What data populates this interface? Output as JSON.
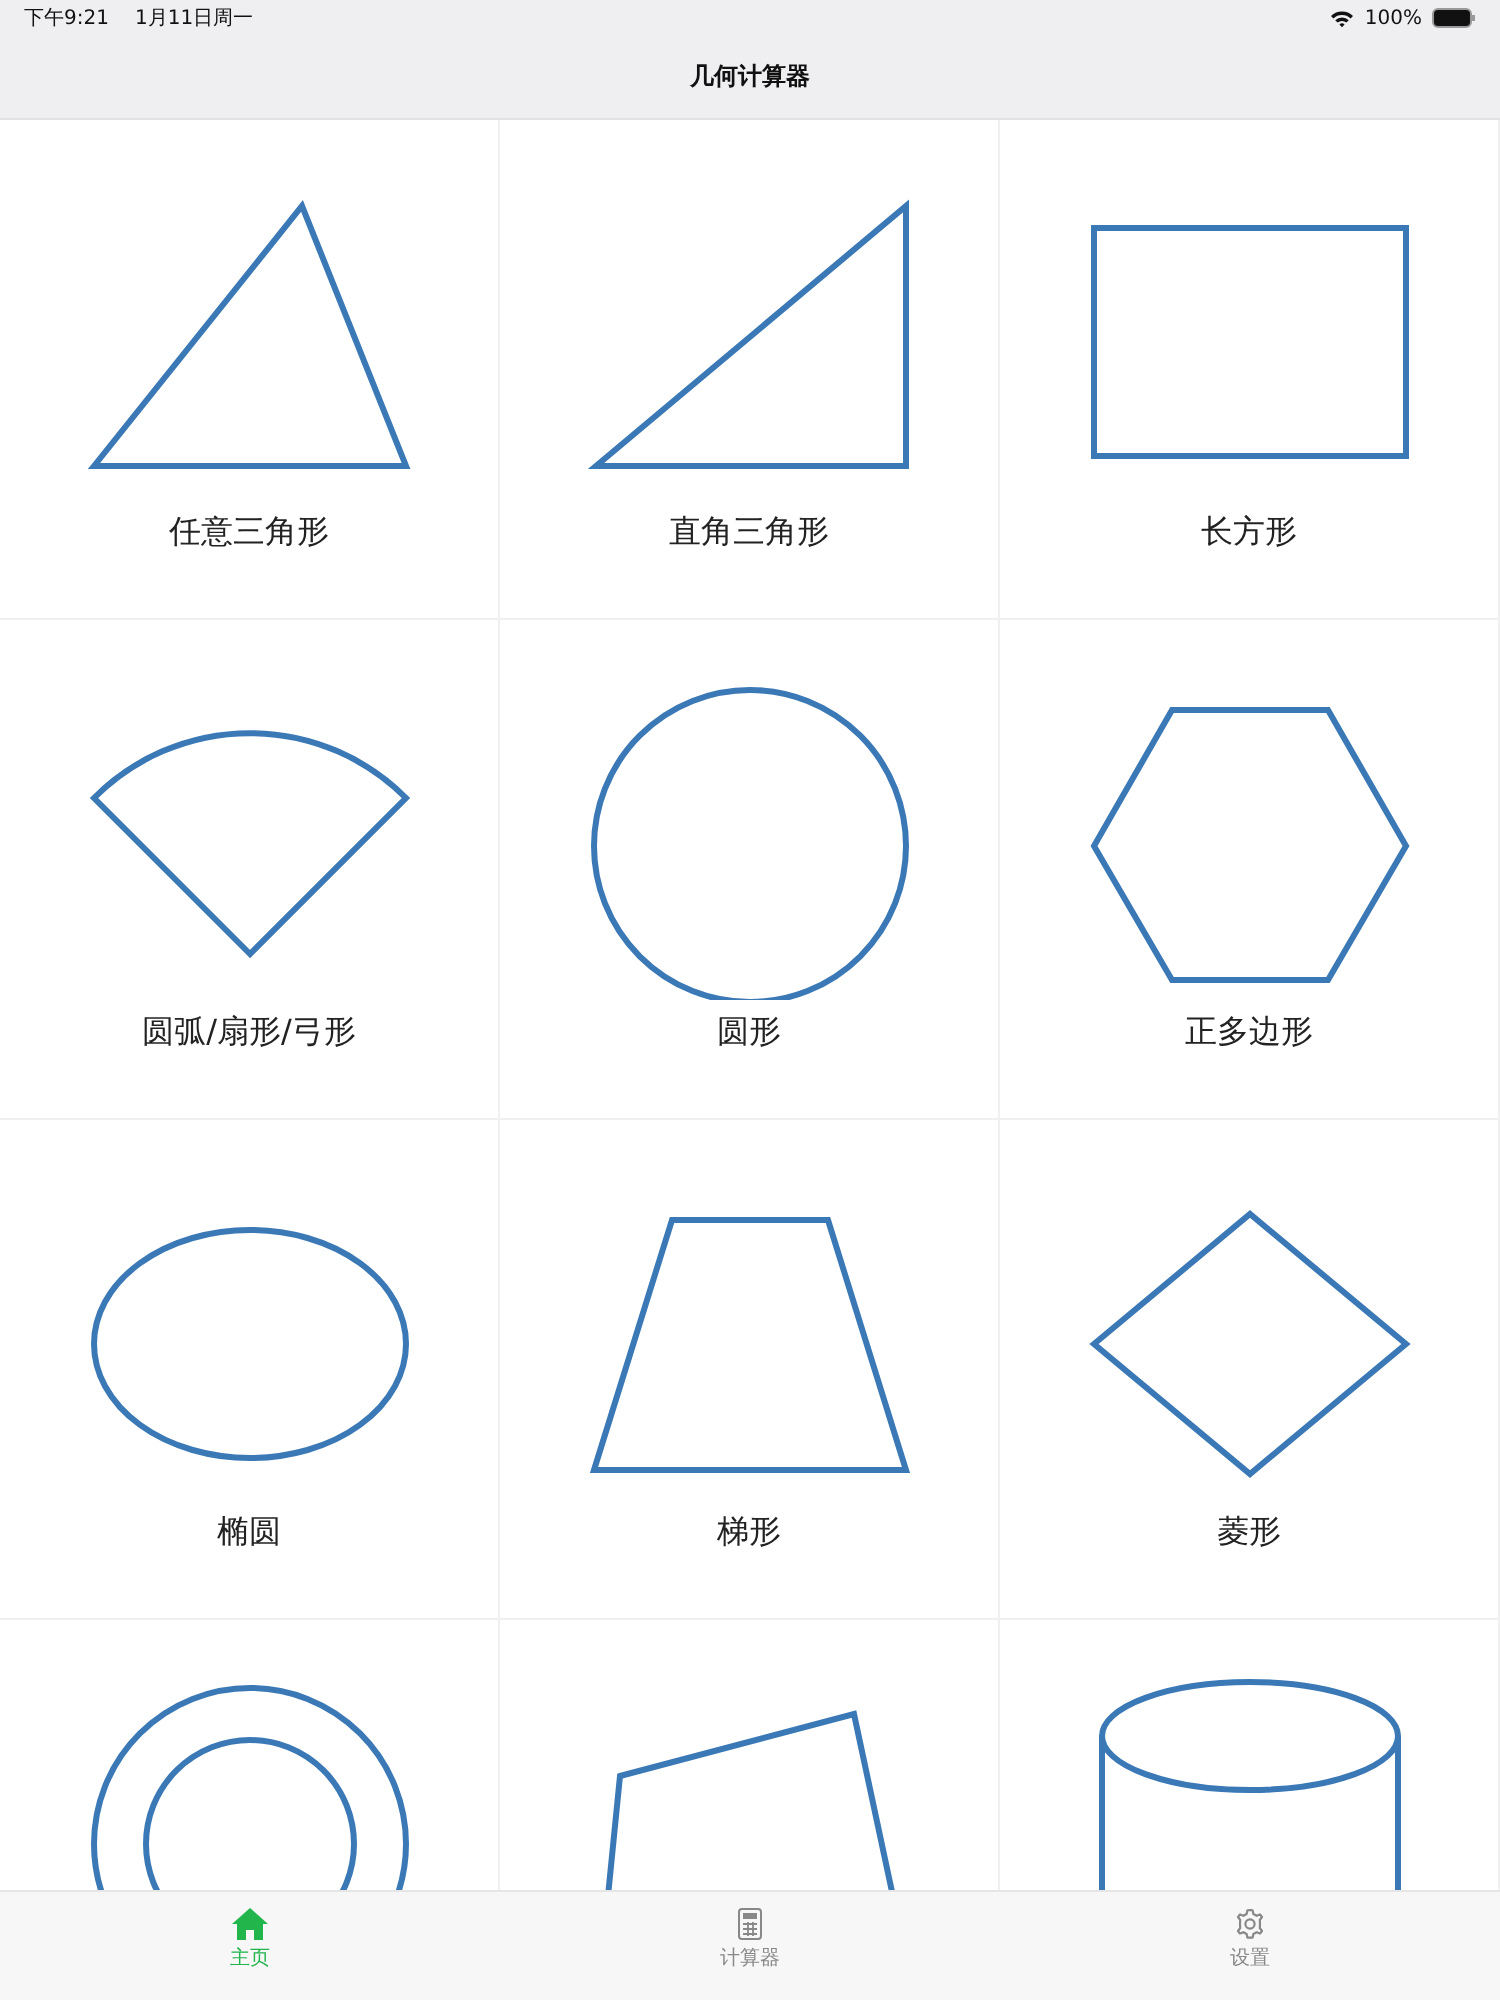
{
  "status_bar": {
    "time": "下午9:21",
    "date": "1月11日周一",
    "battery": "100%"
  },
  "nav_bar": {
    "title": "几何计算器"
  },
  "shapes": [
    {
      "kind": "triangle",
      "label": "任意三角形"
    },
    {
      "kind": "right-triangle",
      "label": "直角三角形"
    },
    {
      "kind": "rectangle",
      "label": "长方形"
    },
    {
      "kind": "sector",
      "label": "圆弧/扇形/弓形"
    },
    {
      "kind": "circle",
      "label": "圆形"
    },
    {
      "kind": "hexagon",
      "label": "正多边形"
    },
    {
      "kind": "ellipse",
      "label": "椭圆"
    },
    {
      "kind": "trapezoid",
      "label": "梯形"
    },
    {
      "kind": "rhombus",
      "label": "菱形"
    },
    {
      "kind": "annulus"
    },
    {
      "kind": "quadrilateral"
    },
    {
      "kind": "cylinder"
    }
  ],
  "tab_bar": [
    {
      "kind": "home",
      "label": "主页",
      "selected": true
    },
    {
      "kind": "calculator",
      "label": "计算器",
      "selected": false
    },
    {
      "kind": "settings",
      "label": "设置",
      "selected": false
    }
  ]
}
